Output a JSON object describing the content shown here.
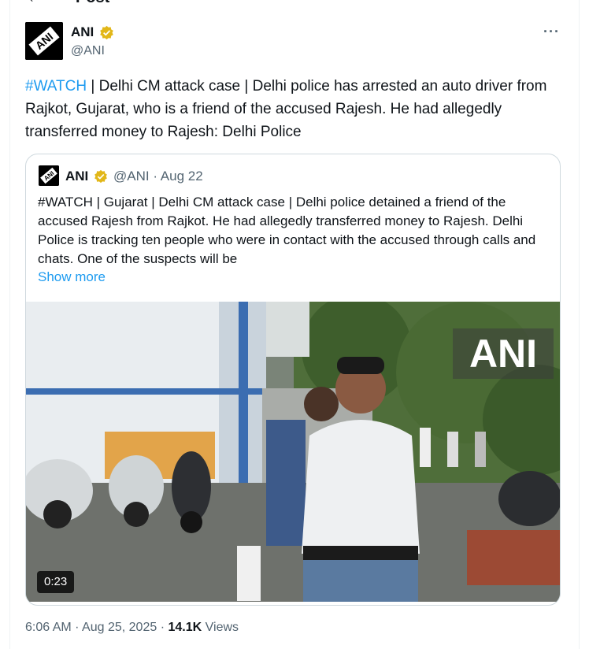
{
  "header": {
    "title": "Post",
    "back_icon": "back-arrow-icon"
  },
  "post": {
    "author_name": "ANI",
    "author_handle": "@ANI",
    "verified_color": "#e2b719",
    "avatar_text": "ANI",
    "more_icon": "more-horizontal-icon",
    "text_hashtag": "#WATCH",
    "text_body": " | Delhi CM attack case | Delhi police has arrested an auto driver from Rajkot, Gujarat, who is a friend of the accused Rajesh. He had allegedly transferred money to Rajesh: Delhi Police",
    "time": "6:06 AM",
    "date": "Aug 25, 2025",
    "views_count": "14.1K",
    "views_label": "Views"
  },
  "quote": {
    "author_name": "ANI",
    "author_handle": "@ANI",
    "date": "Aug 22",
    "text": "#WATCH | Gujarat | Delhi CM attack case | Delhi police detained a friend of the accused Rajesh from Rajkot. He had allegedly transferred money to Rajesh. Delhi Police is tracking ten people who were in contact with the accused through calls and chats. One of the suspects will be",
    "show_more": "Show more",
    "video": {
      "watermark": "ANI",
      "duration": "0:23"
    }
  },
  "colors": {
    "link": "#1d9bf0",
    "secondary_text": "#536471",
    "border": "#cfd9de"
  }
}
